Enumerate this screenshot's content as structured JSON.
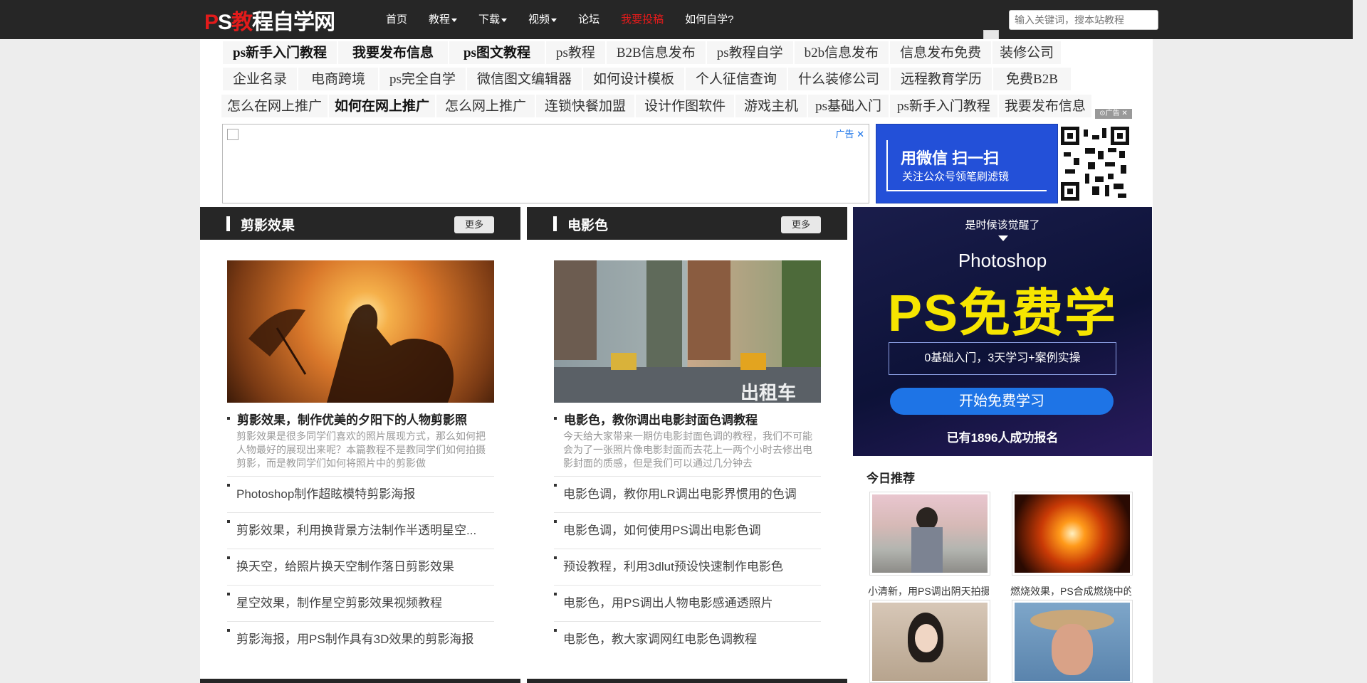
{
  "site": {
    "logo_p": "P",
    "logo_s": "S",
    "logo_red": "教",
    "logo_rest": "程自学网"
  },
  "nav": {
    "items": [
      {
        "label": "首页",
        "dropdown": false,
        "highlight": false
      },
      {
        "label": "教程",
        "dropdown": true,
        "highlight": false
      },
      {
        "label": "下载",
        "dropdown": true,
        "highlight": false
      },
      {
        "label": "视频",
        "dropdown": true,
        "highlight": false
      },
      {
        "label": "论坛",
        "dropdown": false,
        "highlight": false
      },
      {
        "label": "我要投稿",
        "dropdown": false,
        "highlight": true
      },
      {
        "label": "如何自学?",
        "dropdown": false,
        "highlight": false
      }
    ]
  },
  "search": {
    "placeholder": "输入关键词，搜本站教程"
  },
  "keywords": {
    "row1": [
      "ps新手入门教程",
      "我要发布信息",
      "ps图文教程",
      "ps教程",
      "B2B信息发布",
      "ps教程自学",
      "b2b信息发布",
      "信息发布免费",
      "装修公司"
    ],
    "row1_bold": [
      true,
      true,
      true,
      false,
      false,
      false,
      false,
      false,
      false
    ],
    "row2": [
      "企业名录",
      "电商跨境",
      "ps完全自学",
      "微信图文编辑器",
      "如何设计模板",
      "个人征信查询",
      "什么装修公司",
      "远程教育学历",
      "免费B2B"
    ],
    "row3": [
      "怎么在网上推广",
      "如何在网上推广",
      "怎么网上推广",
      "连锁快餐加盟",
      "设计作图软件",
      "游戏主机",
      "ps基础入门",
      "ps新手入门教程",
      "我要发布信息"
    ],
    "row3_bold": [
      false,
      true,
      false,
      false,
      false,
      false,
      false,
      false,
      false
    ]
  },
  "ad": {
    "label": "广告",
    "close": "✕",
    "wechat_line1": "用微信 扫一扫",
    "wechat_line2": "关注公众号领笔刷滤镜",
    "ad_tag": "⊙广告 ✕"
  },
  "columns": [
    {
      "title": "剪影效果",
      "more": "更多",
      "feature_title": "剪影效果，制作优美的夕阳下的人物剪影照",
      "feature_desc": "剪影效果是很多同学们喜欢的照片展现方式，那么如何把人物最好的展现出来呢？本篇教程不是教同学们如何拍摄剪影，而是教同学们如何将照片中的剪影做",
      "list": [
        "Photoshop制作超眩模特剪影海报",
        "剪影效果，利用换背景方法制作半透明星空...",
        "换天空，给照片换天空制作落日剪影效果",
        "星空效果，制作星空剪影效果视频教程",
        "剪影海报，用PS制作具有3D效果的剪影海报"
      ]
    },
    {
      "title": "电影色",
      "more": "更多",
      "feature_title": "电影色，教你调出电影封面色调教程",
      "feature_desc": "今天给大家带来一期仿电影封面色调的教程，我们不可能会为了一张照片像电影封面而去花上一两个小时去修出电影封面的质感，但是我们可以通过几分钟去",
      "list": [
        "电影色调，教你用LR调出电影界惯用的色调",
        "电影色调，如何使用PS调出电影色调",
        "预设教程，利用3dlut预设快速制作电影色",
        "电影色，用PS调出人物电影感通透照片",
        "电影色，教大家调网红电影色调教程"
      ]
    }
  ],
  "ps_ad": {
    "line1": "是时候该觉醒了",
    "line2": "Photoshop",
    "line3": "PS免费学",
    "line4": "0基础入门，3天学习+案例实操",
    "button": "开始免费学习",
    "line5": "已有1896人成功报名"
  },
  "today": {
    "title": "今日推荐",
    "items": [
      {
        "caption": "小清新，用PS调出阴天拍摄"
      },
      {
        "caption": "燃烧效果，PS合成燃烧中的"
      },
      {
        "caption": ""
      },
      {
        "caption": ""
      }
    ]
  }
}
